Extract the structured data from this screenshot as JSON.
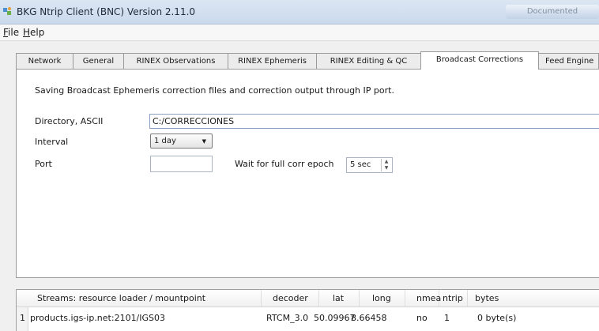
{
  "window": {
    "title": "BKG Ntrip Client (BNC) Version 2.11.0",
    "right_text": "Documented",
    "icon": "bnc-app-icon"
  },
  "menu": [
    {
      "label": "File"
    },
    {
      "label": "Help"
    }
  ],
  "tabs": [
    {
      "label": "Network",
      "active": false
    },
    {
      "label": "General",
      "active": false
    },
    {
      "label": "RINEX Observations",
      "active": false
    },
    {
      "label": "RINEX Ephemeris",
      "active": false
    },
    {
      "label": "RINEX Editing & QC",
      "active": false
    },
    {
      "label": "Broadcast Corrections",
      "active": true
    },
    {
      "label": "Feed Engine",
      "active": false
    }
  ],
  "panel": {
    "description": "Saving Broadcast Ephemeris correction files and correction output through IP port.",
    "directory_label": "Directory, ASCII",
    "directory_value": "C:/CORRECCIONES",
    "interval_label": "Interval",
    "interval_value": "1 day",
    "port_label": "Port",
    "port_value": "",
    "wait_label": "Wait for full corr epoch",
    "wait_value": "5 sec"
  },
  "streams": {
    "headers": [
      "Streams:  resource loader / mountpoint",
      "decoder",
      "lat",
      "long",
      "nmea",
      "ntrip",
      "bytes"
    ],
    "rows": [
      {
        "num": "1",
        "mountpoint": "products.igs-ip.net:2101/IGS03",
        "decoder": "RTCM_3.0",
        "lat": "50.09967",
        "long": "8.66458",
        "nmea": "no",
        "ntrip": "1",
        "bytes": "0 byte(s)"
      }
    ]
  }
}
